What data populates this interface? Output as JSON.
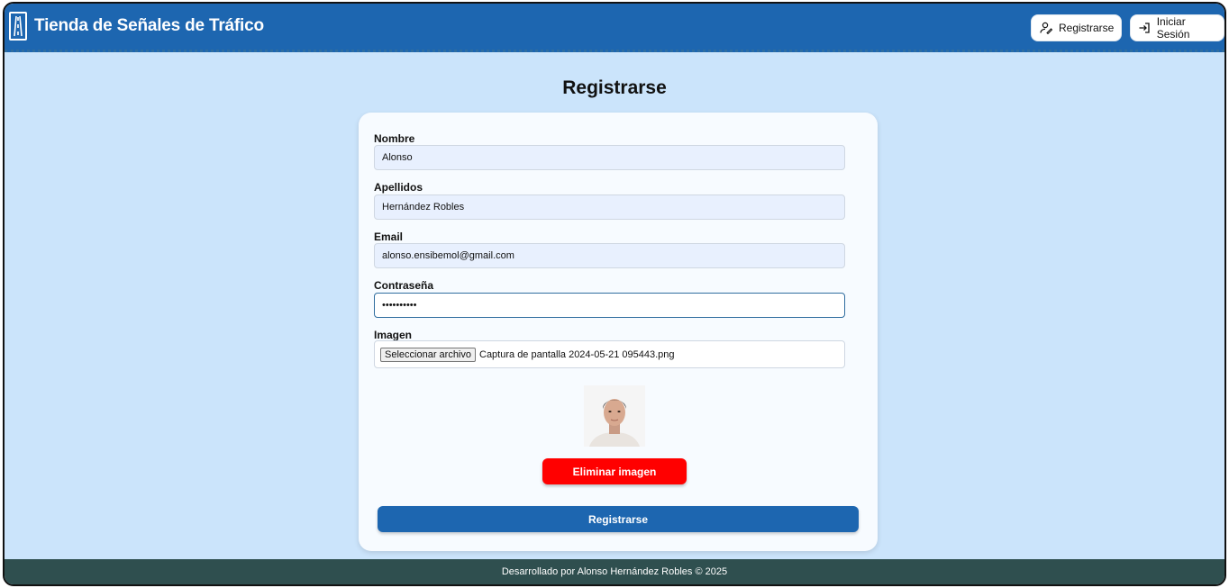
{
  "header": {
    "brand": "Tienda de Señales de Tráfico",
    "register_label": "Registrarse",
    "login_label": "Iniciar Sesión",
    "bg_color": "#1d66b0"
  },
  "page": {
    "title": "Registrarse"
  },
  "form": {
    "nombre_label": "Nombre",
    "nombre_value": "Alonso",
    "apellidos_label": "Apellidos",
    "apellidos_value": "Hernández Robles",
    "email_label": "Email",
    "email_value": "alonso.ensibemol@gmail.com",
    "password_label": "Contraseña",
    "password_value": "••••••••••",
    "imagen_label": "Imagen",
    "file_button": "Seleccionar archivo",
    "file_name": "Captura de pantalla 2024-05-21 095443.png",
    "remove_image": "Eliminar imagen",
    "submit": "Registrarse"
  },
  "footer": {
    "text": "Desarrollado por Alonso Hernández Robles © 2025"
  },
  "icons": {
    "logo": "road-sign-icon",
    "register": "user-pen-icon",
    "login": "log-in-icon"
  },
  "colors": {
    "accent": "#1d66b0",
    "danger": "#ff0000",
    "footer": "#2f4f4f",
    "background": "#cbe4fb"
  }
}
